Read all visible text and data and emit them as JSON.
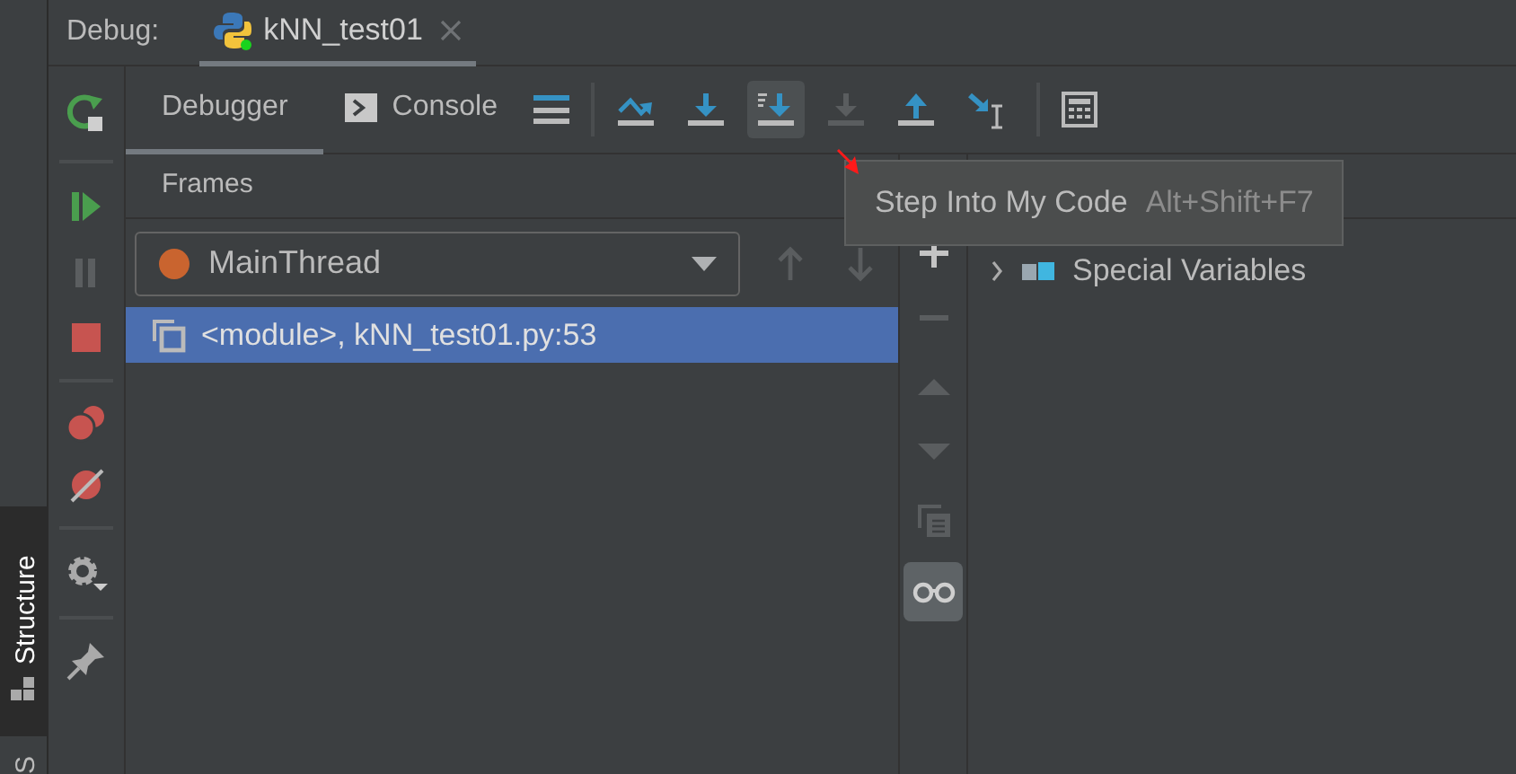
{
  "debug_label": "Debug:",
  "run_tab": {
    "label": "kNN_test01",
    "selected": true
  },
  "tabs": [
    {
      "label": "Debugger",
      "selected": true
    },
    {
      "label": "Console",
      "selected": false
    }
  ],
  "step_buttons": [
    {
      "kind": "step-over",
      "disabled": false,
      "hovered": false
    },
    {
      "kind": "step-into",
      "disabled": false,
      "hovered": false
    },
    {
      "kind": "step-into-my-code",
      "disabled": false,
      "hovered": true
    },
    {
      "kind": "force-step-into",
      "disabled": true,
      "hovered": false
    },
    {
      "kind": "step-out",
      "disabled": false,
      "hovered": false
    },
    {
      "kind": "run-to-cursor",
      "disabled": false,
      "hovered": false
    }
  ],
  "frames": {
    "title": "Frames",
    "thread": "MainThread",
    "items": [
      {
        "label": "<module>, kNN_test01.py:53",
        "selected": true
      }
    ]
  },
  "variables": {
    "items": [
      {
        "label": "Special Variables",
        "expanded": false
      }
    ]
  },
  "watches_toggle": {
    "selected": true
  },
  "tooltip": {
    "text": "Step Into My Code",
    "shortcut": "Alt+Shift+F7"
  },
  "tool_window_tabs": [
    {
      "label": "Structure",
      "selected": true
    },
    {
      "label": "S",
      "selected": false
    }
  ]
}
